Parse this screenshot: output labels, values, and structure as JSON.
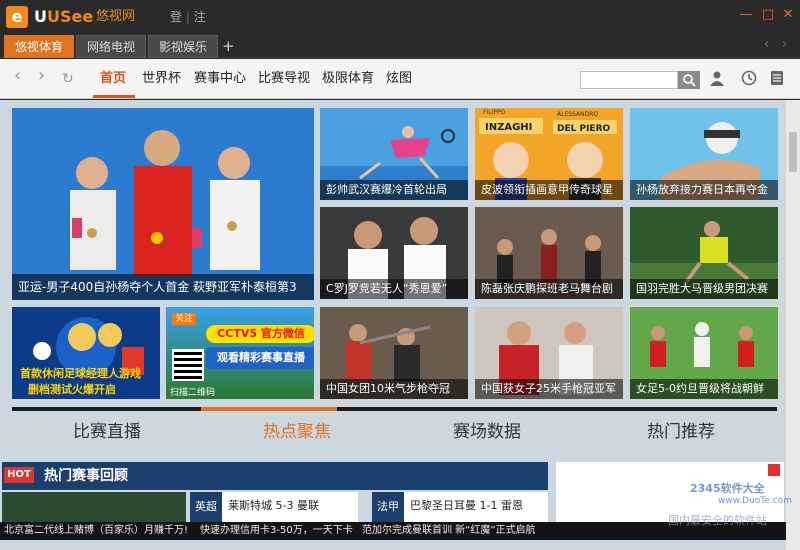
{
  "app": {
    "logo_letter": "e",
    "logo_name_pre": "U",
    "logo_name_rest": "USee",
    "logo_cn": "悠视网",
    "login_label": "登",
    "register_label": "注"
  },
  "window_controls": [
    "—",
    "□",
    "✕"
  ],
  "tabs": [
    {
      "label": "悠视体育",
      "active": true
    },
    {
      "label": "网络电视",
      "active": false
    },
    {
      "label": "影视娱乐",
      "active": false
    }
  ],
  "tab_add": "+",
  "tab_prev": "‹",
  "tab_next": "›",
  "nav": {
    "back": "‹",
    "forward": "›",
    "refresh": "↻",
    "links": [
      "首页",
      "世界杯",
      "赛事中心",
      "比赛导视",
      "极限体育",
      "炫图"
    ],
    "search_placeholder": "",
    "search_icon": "magnifier-icon",
    "user_icon": "user-icon",
    "history_icon": "clock-icon",
    "notes_icon": "notes-icon"
  },
  "tiles": {
    "big": "亚运-男子400自孙杨夺个人首金 萩野亚军朴泰桓第3",
    "t1": "彭帅武汉赛爆冷首轮出局",
    "t2": "皮波领衔插画意甲传奇球星",
    "t3": "孙杨放弃接力赛日本再夺金",
    "t4": "C罗J罗竞若无人“秀恩爱”",
    "t5": "陈磊张庆鹏探班老马舞台剧",
    "t6": "国羽完胜大马晋级男团决赛",
    "t8": "中国女团10米气步枪夺冠",
    "t9": "中国获女子25米手枪冠亚军",
    "t10": "女足5-0约旦晋级将战朝鲜"
  },
  "tile_art": {
    "t2_names": [
      "FILIPPO",
      "INZAGHI",
      "ALESSANDRO",
      "DEL PIERO"
    ]
  },
  "ads": {
    "ad1_line1": "首款休闲足球经理人游戏",
    "ad1_line2": "删档测试火爆开启",
    "ad2_tag": "关注",
    "ad2_line1": "CCTV5 官方微信",
    "ad2_line2": "观看精彩赛事直播",
    "ad2_qr": "扫描二维码"
  },
  "section_tabs": [
    "比赛直播",
    "热点聚焦",
    "赛场数据",
    "热门推荐"
  ],
  "hot": {
    "badge": "HOT",
    "title": "热门赛事回顾",
    "matches": [
      {
        "league": "英超",
        "text": "莱斯特城 5-3 曼联"
      },
      {
        "league": "法甲",
        "text": "巴黎圣日耳曼 1-1 雷恩"
      }
    ]
  },
  "ticker": [
    "北京富二代线上赌博（百家乐）月赚千万!",
    "快速办理信用卡3-50万，一天下卡",
    "范加尔完成曼联首训 新“红魔”正式启航"
  ],
  "watermark": {
    "brand": "2345软件大全",
    "url": "www.DuoTe.com",
    "slogan": "国内最安全的软件站"
  },
  "colors": {
    "accent": "#e0731e",
    "brand_orange": "#f08a1c",
    "hot_red": "#d9362e",
    "dark_blue": "#1a3f6e"
  }
}
